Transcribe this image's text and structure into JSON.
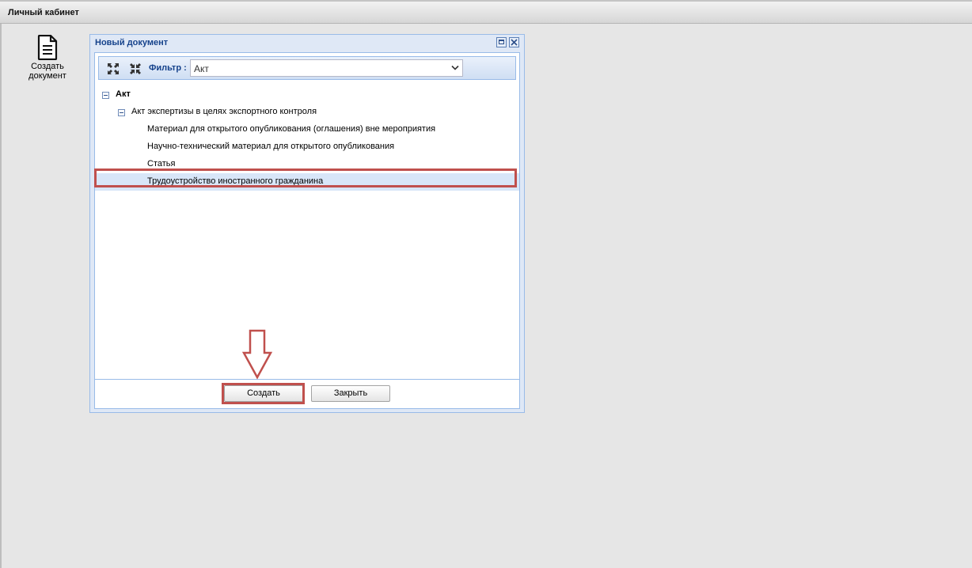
{
  "header": {
    "title": "Личный кабинет"
  },
  "desktop": {
    "create_doc": {
      "icon": "document-icon",
      "label_line1": "Создать",
      "label_line2": "документ"
    }
  },
  "dialog": {
    "title": "Новый документ",
    "tools": {
      "maximize": "maximize-icon",
      "close": "close-icon"
    },
    "toolbar": {
      "expand_icon": "expand-all-icon",
      "collapse_icon": "collapse-all-icon",
      "filter_label": "Фильтр :",
      "filter_value": "Акт"
    },
    "tree": {
      "root": "Акт",
      "group": "Акт экспертизы в целях экспортного контроля",
      "items": [
        "Материал для открытого опубликования (оглашения) вне мероприятия",
        "Научно-технический материал для открытого опубликования",
        "Статья",
        "Трудоустройство иностранного гражданина"
      ],
      "selected_index": 3
    },
    "buttons": {
      "create": "Создать",
      "close": "Закрыть"
    },
    "annotation": {
      "highlight_color": "#c0504d"
    }
  }
}
